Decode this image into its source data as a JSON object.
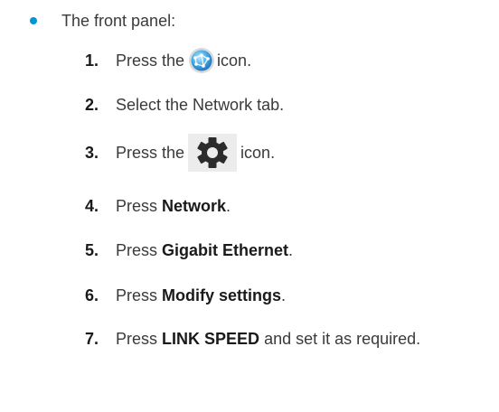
{
  "bullet": {
    "text": "The front panel:"
  },
  "steps": [
    {
      "num": "1.",
      "before": "Press the",
      "icon": "globe-network-icon",
      "after": "icon."
    },
    {
      "num": "2.",
      "text": "Select the Network tab."
    },
    {
      "num": "3.",
      "before": "Press the",
      "icon": "gear-icon",
      "after": "icon."
    },
    {
      "num": "4.",
      "before": "Press",
      "bold": "Network",
      "after": "."
    },
    {
      "num": "5.",
      "before": "Press",
      "bold": "Gigabit Ethernet",
      "after": "."
    },
    {
      "num": "6.",
      "before": "Press",
      "bold": "Modify settings",
      "after": "."
    },
    {
      "num": "7.",
      "before": "Press",
      "bold": "LINK SPEED",
      "after": "and set it as required."
    }
  ],
  "colors": {
    "bullet": "#0096d6",
    "text": "#3a3a3a",
    "emphasis": "#1a1a1a"
  }
}
